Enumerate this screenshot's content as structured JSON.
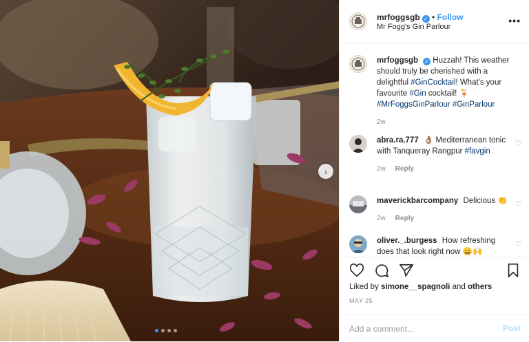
{
  "header": {
    "username": "mrfoggsgb",
    "separator": "•",
    "follow_label": "Follow",
    "location": "Mr Fogg's Gin Parlour",
    "more_label": "•••"
  },
  "caption": {
    "username": "mrfoggsgb",
    "text_1": "Huzzah! This weather should truly be cherished with a delightful ",
    "tag_1": "#GinCocktail",
    "text_2": "! What's your favourite ",
    "tag_2": "#Gin",
    "text_3": " cocktail! 🍹",
    "tag_3": "#MrFoggsGinParlour",
    "tag_4": "#GinParlour",
    "time": "2w"
  },
  "comments": [
    {
      "username": "abra.ra.777",
      "text": "👌🏽 Mediterranean tonic with Tanqueray Rangpur",
      "tag": "#favgin",
      "time": "2w",
      "reply_label": "Reply"
    },
    {
      "username": "maverickbarcompany",
      "text": "Delicious 👏",
      "time": "2w",
      "reply_label": "Reply"
    },
    {
      "username": "oliver._.burgess",
      "text": "How refreshing does that look right now 😀🙌",
      "time": "",
      "reply_label": ""
    }
  ],
  "actions": {
    "liked_by_prefix": "Liked by ",
    "liked_by_user": "simone__spagnoli",
    "liked_by_and": " and ",
    "liked_by_others": "others",
    "date": "MAY 25"
  },
  "add_comment": {
    "placeholder": "Add a comment...",
    "post_label": "Post"
  },
  "photo": {
    "next_arrow": "›",
    "slide_count": 4,
    "active_slide": 1
  },
  "icons": {
    "heart": "heart-icon",
    "comment": "comment-icon",
    "share": "share-icon",
    "bookmark": "bookmark-icon",
    "verified": "verified-badge-icon"
  },
  "colors": {
    "link_blue": "#3897f0",
    "hashtag": "#003569",
    "muted": "#8e8e8e",
    "post_disabled": "#b2dffc"
  }
}
